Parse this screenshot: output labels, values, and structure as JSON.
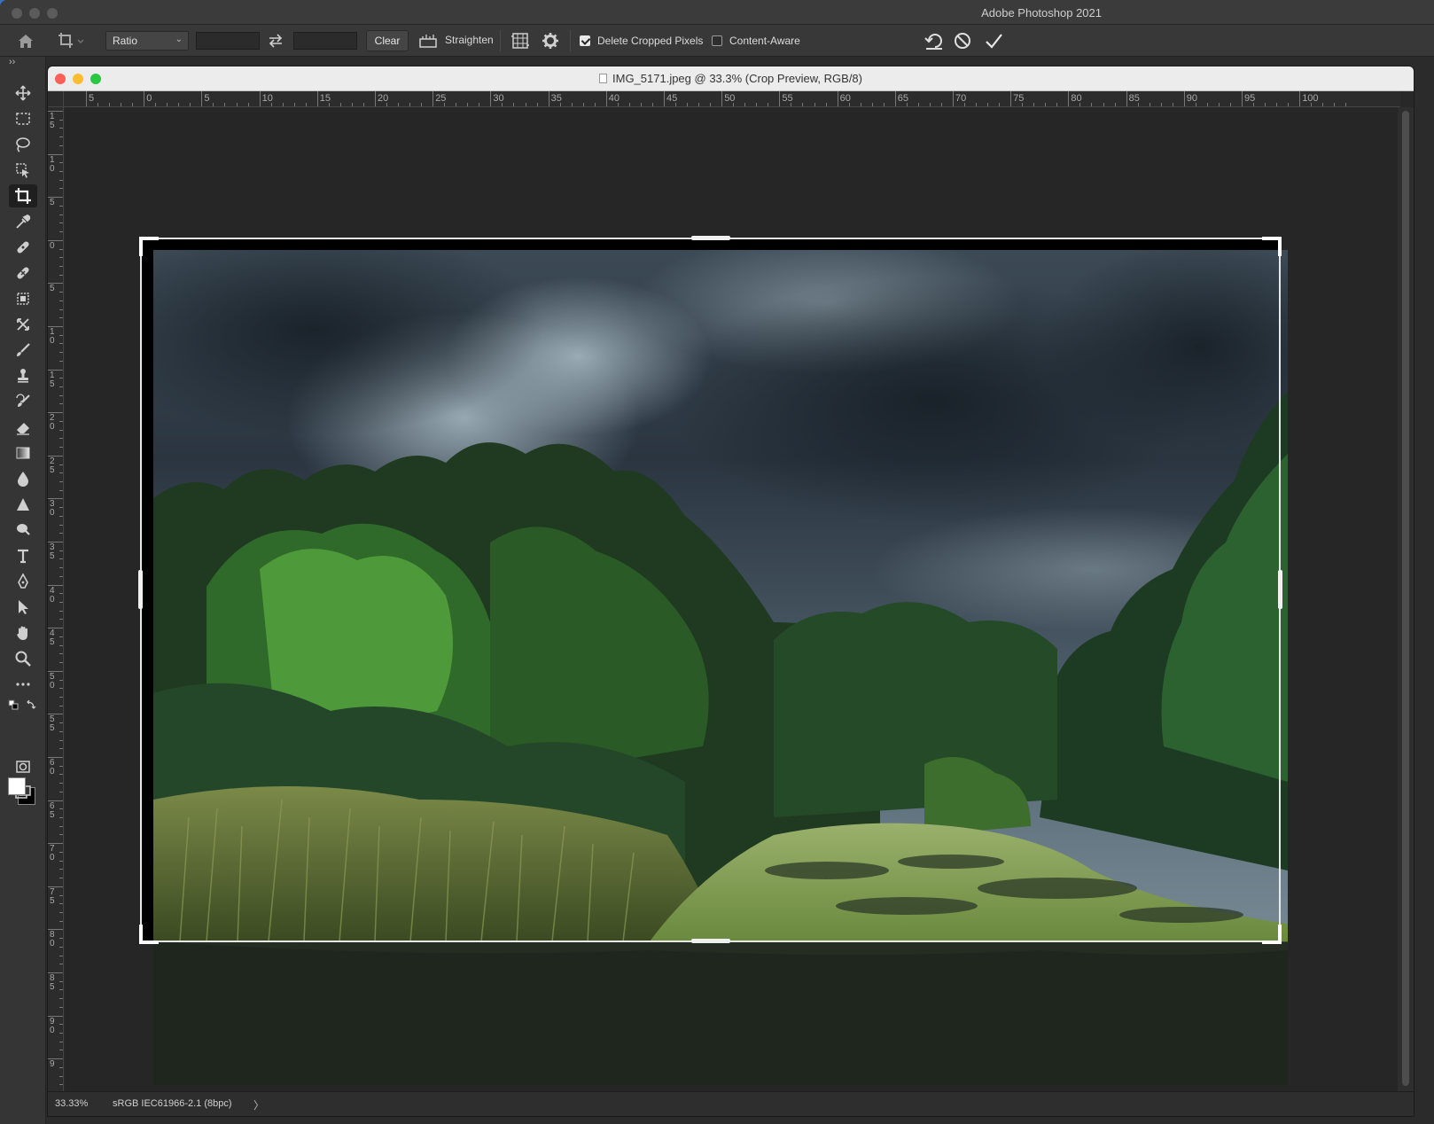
{
  "app": {
    "title": "Adobe Photoshop 2021"
  },
  "options_bar": {
    "ratio_select": "Ratio",
    "width_value": "",
    "height_value": "",
    "clear_label": "Clear",
    "straighten_label": "Straighten",
    "delete_cropped_label": "Delete Cropped Pixels",
    "delete_cropped_checked": true,
    "content_aware_label": "Content-Aware",
    "content_aware_checked": false
  },
  "toolbar": {
    "tools": [
      "move-tool",
      "marquee-tool",
      "lasso-tool",
      "object-selection-tool",
      "crop-tool",
      "eyedropper-tool",
      "spot-healing-tool",
      "healing-brush-tool",
      "patch-tool",
      "content-aware-move-tool",
      "brush-tool",
      "clone-stamp-tool",
      "history-brush-tool",
      "eraser-tool",
      "gradient-tool",
      "blur-tool",
      "sharpen-tool",
      "dodge-tool",
      "type-tool",
      "pen-tool",
      "path-selection-tool",
      "hand-tool",
      "zoom-tool",
      "more-tools"
    ],
    "active_tool": "crop-tool",
    "foreground_color": "#ffffff",
    "background_color": "#000000"
  },
  "document": {
    "title": "IMG_5171.jpeg @ 33.3% (Crop Preview, RGB/8)",
    "ruler_h_labels": [
      "5",
      "0",
      "5",
      "10",
      "15",
      "20",
      "25",
      "30",
      "35",
      "40",
      "45",
      "50",
      "55",
      "60",
      "65",
      "70",
      "75",
      "80",
      "85",
      "90",
      "95",
      "100"
    ],
    "ruler_v_labels": [
      "1\n5",
      "1\n0",
      "5",
      "0",
      "5",
      "1\n0",
      "1\n5",
      "2\n0",
      "2\n5",
      "3\n0",
      "3\n5",
      "4\n0",
      "4\n5",
      "5\n0",
      "5\n5",
      "6\n0",
      "6\n5",
      "7\n0",
      "7\n5",
      "8\n0",
      "8\n5",
      "9\n0",
      "9"
    ],
    "zoom": "33.33%",
    "color_profile": "sRGB IEC61966-2.1 (8bpc)",
    "status_arrow": "〉"
  },
  "colors": {
    "app_bg": "#2b2b2b",
    "panel": "#353535",
    "close": "#fe5f57",
    "minimize": "#febc2e",
    "zoom": "#28c840"
  }
}
